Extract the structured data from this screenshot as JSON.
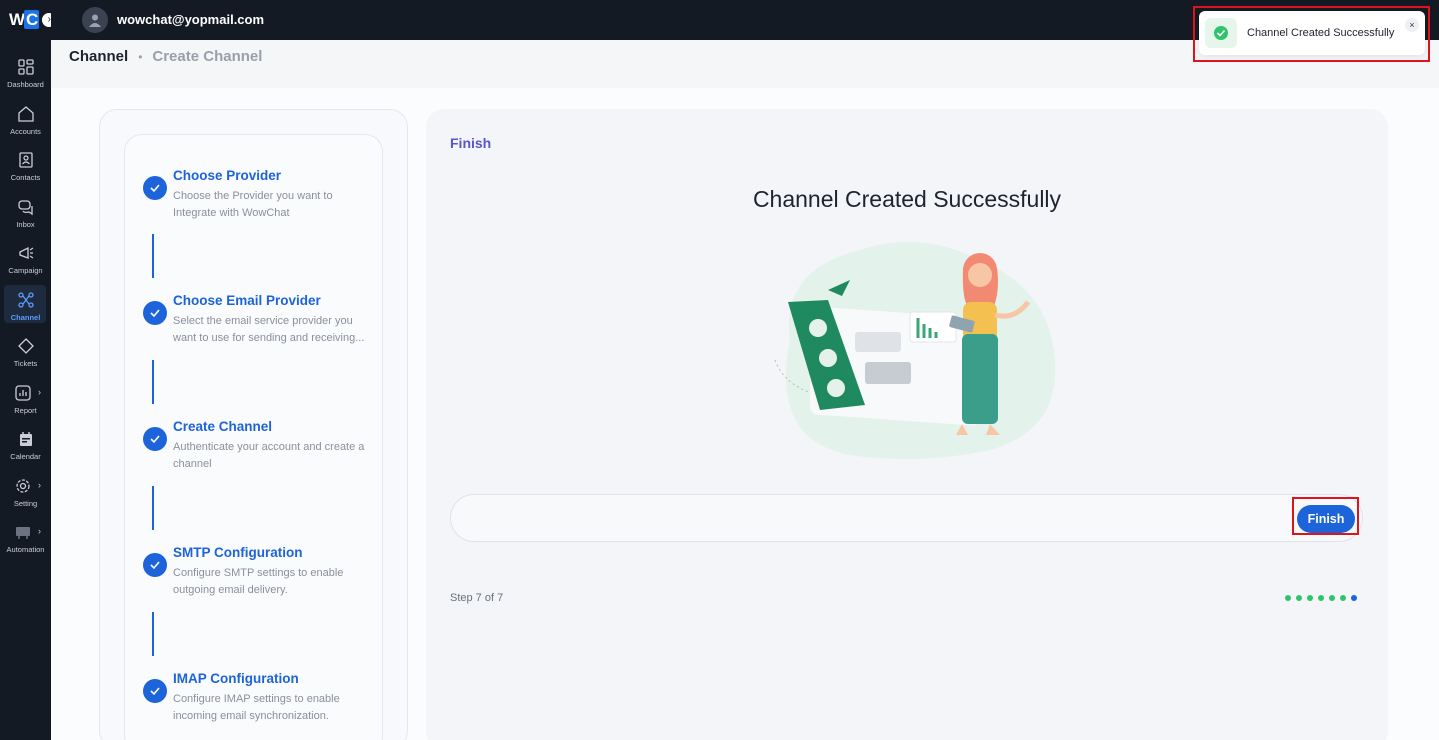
{
  "brand": {
    "logo_w": "W",
    "logo_c": "C"
  },
  "header": {
    "user_email": "wowchat@yopmail.com"
  },
  "sidebar": {
    "items": [
      {
        "label": "Dashboard",
        "icon": "dashboard-icon"
      },
      {
        "label": "Accounts",
        "icon": "home-icon"
      },
      {
        "label": "Contacts",
        "icon": "contact-card-icon"
      },
      {
        "label": "Inbox",
        "icon": "chat-bubbles-icon"
      },
      {
        "label": "Campaign",
        "icon": "megaphone-icon"
      },
      {
        "label": "Channel",
        "icon": "channel-network-icon",
        "active": true
      },
      {
        "label": "Tickets",
        "icon": "ticket-icon"
      },
      {
        "label": "Report",
        "icon": "report-chart-icon",
        "expandable": true
      },
      {
        "label": "Calendar",
        "icon": "calendar-icon"
      },
      {
        "label": "Setting",
        "icon": "gear-icon",
        "expandable": true
      },
      {
        "label": "Automation",
        "icon": "automation-icon",
        "expandable": true
      }
    ]
  },
  "breadcrumb": {
    "current": "Channel",
    "sub": "Create Channel"
  },
  "steps": [
    {
      "title": "Choose Provider",
      "desc": "Choose the Provider you want to Integrate with WowChat"
    },
    {
      "title": "Choose Email Provider",
      "desc": "Select the email service provider you want to use for sending and receiving..."
    },
    {
      "title": "Create Channel",
      "desc": "Authenticate your account and create a channel"
    },
    {
      "title": "SMTP Configuration",
      "desc": "Configure SMTP settings to enable outgoing email delivery."
    },
    {
      "title": "IMAP Configuration",
      "desc": "Configure IMAP settings to enable incoming email synchronization."
    }
  ],
  "content": {
    "tab_label": "Finish",
    "headline": "Channel Created Successfully",
    "finish_button": "Finish",
    "step_count": "Step 7 of 7",
    "total_steps": 7,
    "current_step": 7
  },
  "toast": {
    "message": "Channel Created Successfully",
    "close": "×"
  },
  "colors": {
    "accent": "#1d63d9",
    "success": "#2ec56a",
    "sidebar_bg": "#141a24",
    "highlight": "#e0121b"
  }
}
